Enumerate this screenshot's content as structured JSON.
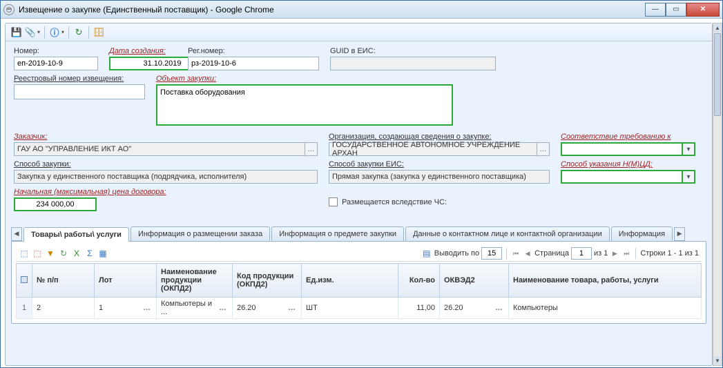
{
  "window": {
    "title": "Извещение о закупке (Единственный поставщик) - Google Chrome"
  },
  "form": {
    "number_label": "Номер:",
    "number_value": "еп-2019-10-9",
    "create_date_label": "Дата создания:",
    "create_date_value": "31.10.2019",
    "reg_number_label": "Рег.номер:",
    "reg_number_value": "рз-2019-10-6",
    "guid_label": "GUID в ЕИС:",
    "guid_value": "",
    "registry_number_label": "Реестровый номер извещения:",
    "registry_number_value": "",
    "object_label": "Объект закупки:",
    "object_value": "Поставка оборудования",
    "customer_label": "Заказчик:",
    "customer_value": "ГАУ АО \"УПРАВЛЕНИЕ ИКТ АО\"",
    "org_creating_label": "Организация, создающая сведения о закупке:",
    "org_creating_value": "ГОСУДАРСТВЕННОЕ АВТОНОМНОЕ УЧРЕЖДЕНИЕ АРХАН",
    "compliance_label": "Соответствие требованию к",
    "compliance_value": "",
    "purchase_method_label": "Способ закупки:",
    "purchase_method_value": "Закупка у единственного поставщика (подрядчика, исполнителя)",
    "purchase_method_eis_label": "Способ закупки ЕИС:",
    "purchase_method_eis_value": "Прямая закупка (закупка у единственного поставщика)",
    "nmcd_method_label": "Способ указания Н(М)ЦД:",
    "nmcd_method_value": "",
    "initial_price_label": "Начальная (максимальная) цена договора:",
    "initial_price_value": "234 000,00",
    "emergency_label": "Размещается вследствие ЧС:"
  },
  "tabs": [
    "Товары\\ работы\\ услуги",
    "Информация о размещении заказа",
    "Информация о предмете закупки",
    "Данные о контактном лице и контактной организации",
    "Информация"
  ],
  "grid": {
    "paging_label": "Выводить по",
    "page_size": "15",
    "page_label": "Страница",
    "page_num": "1",
    "page_of": "из 1",
    "rows_info": "Строки 1 - 1 из 1",
    "columns": {
      "seq": "№ п/п",
      "lot": "Лот",
      "name_okpd2": "Наименование продукции (ОКПД2)",
      "code_okpd2": "Код продукции (ОКПД2)",
      "unit": "Ед.изм.",
      "qty": "Кол-во",
      "okved2": "ОКВЭД2",
      "goods_name": "Наименование товара, работы, услуги"
    },
    "rows": [
      {
        "rownum": "1",
        "seq": "2",
        "lot": "1",
        "name_okpd2": "Компьютеры и ...",
        "code_okpd2": "26.20",
        "unit": "ШТ",
        "qty": "11,00",
        "okved2": "26.20",
        "goods_name": "Компьютеры"
      }
    ]
  }
}
